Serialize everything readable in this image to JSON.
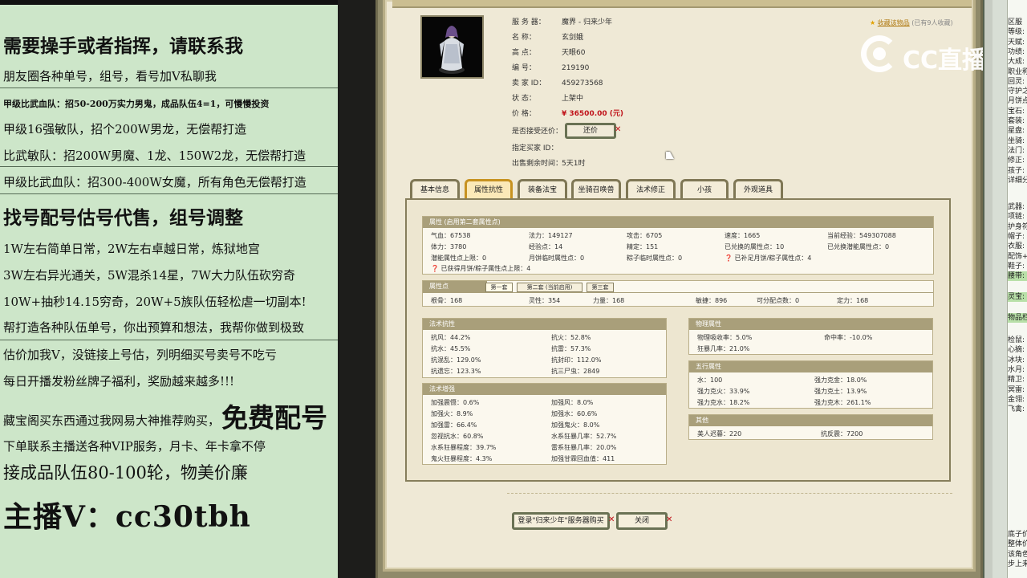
{
  "left_panel": {
    "lines": [
      "需要操手或者指挥，请联系我",
      "朋友圈各种单号，组号，看号加V私聊我",
      "甲级比武血队：招50-200万实力男鬼，成品队伍4=1，可慢慢投资",
      "甲级16强敏队，招个200W男龙，无偿帮打造",
      "比武敏队：招200W男魔、1龙、150W2龙，无偿帮打造",
      "甲级比武血队：招300-400W女魔，所有角色无偿帮打造",
      "找号配号估号代售，组号调整",
      "1W左右简单日常，2W左右卓越日常，炼狱地宫",
      "3W左右异光通关，5W混杀14星，7W大力队伍砍穷奇",
      "10W+抽秒14.15穷奇，20W+5族队伍轻松虐一切副本!",
      "帮打造各种队伍单号，你出预算和想法，我帮你做到极致",
      "估价加我V，没链接上号估，列明细买号卖号不吃亏",
      "每日开播发粉丝牌子福利，奖励越来越多!!!",
      "藏宝阁买东西通过我网易大神推荐购买，",
      "免费配号",
      "下单联系主播送各种VIP服务，月卡、年卡拿不停",
      "接成品队伍80-100轮，物美价廉",
      "主播V：cc30tbh"
    ]
  },
  "game": {
    "info": [
      {
        "label": "服 务 器：",
        "value": "魔界 - 归来少年"
      },
      {
        "label": "名      称：",
        "value": "玄剑娥"
      },
      {
        "label": "高      点：",
        "value": "天眼60"
      },
      {
        "label": "编      号：",
        "value": "219190"
      },
      {
        "label": "卖 家  ID：",
        "value": "459273568"
      },
      {
        "label": "状      态：",
        "value": "上架中"
      },
      {
        "label": "价      格：",
        "value": "¥ 36500.00 (元)"
      },
      {
        "label": "是否接受还价：",
        "value": ""
      },
      {
        "label": "指定买家 ID：",
        "value": ""
      },
      {
        "label": "出售剩余时间：",
        "value": "5天1时"
      }
    ],
    "return_price_button": "还价",
    "favorite": {
      "link": "收藏该物品",
      "count": "(已有9人收藏)"
    },
    "tabs": [
      "基本信息",
      "属性抗性",
      "装备法宝",
      "坐骑召唤兽",
      "法术修正",
      "小孩",
      "外观道具"
    ],
    "active_tab": 1,
    "attributes": {
      "header": "属性 (启用第二套属性点)",
      "rows": [
        [
          "气血：67538",
          "法力：149127",
          "攻击：6705",
          "速度：1665",
          "当前经验：549307088"
        ],
        [
          "体力：3780",
          "经验点：14",
          "精定：151",
          "已兑换的属性点：10",
          "已兑换潜能属性点：0"
        ],
        [
          "潜能属性点上限：0",
          "月饼临时属性点：0",
          "粽子临时属性点：0",
          "已补足月饼/粽子属性点：4",
          ""
        ],
        [
          "已获得月饼/粽子属性点上限：4",
          "",
          "",
          "",
          ""
        ]
      ]
    },
    "points": {
      "header": "属性点",
      "subtabs": [
        "第一套",
        "第二套 (当前启用)",
        "第三套"
      ],
      "row": [
        "根骨：168",
        "灵性：354",
        "力量：168",
        "敏捷：896",
        "可分配点数：0",
        "定力：168"
      ]
    },
    "resist": {
      "header": "法术抗性",
      "rows": [
        [
          "抗风：44.2%",
          "抗火：52.8%"
        ],
        [
          "抗水：45.5%",
          "抗雷：57.3%"
        ],
        [
          "抗混乱：129.0%",
          "抗封印：112.0%"
        ],
        [
          "抗遗忘：123.3%",
          "抗三尸虫：2849"
        ]
      ]
    },
    "enhance": {
      "header": "法术增强",
      "rows": [
        [
          "加强震慑：0.6%",
          "加强风：8.0%"
        ],
        [
          "加强火：8.9%",
          "加强水：60.6%"
        ],
        [
          "加强雷：66.4%",
          "加强鬼火：8.0%"
        ],
        [
          "忽视抗水：60.8%",
          "水系狂暴几率：52.7%"
        ],
        [
          "水系狂暴程度：39.7%",
          "雷系狂暴几率：20.0%"
        ],
        [
          "鬼火狂暴程度：4.3%",
          "加强甘霖回血值：411"
        ]
      ]
    },
    "physical": {
      "header": "物理属性",
      "rows": [
        [
          "物理吸收率：5.0%",
          "命中率：-10.0%"
        ],
        [
          "狂暴几率：21.0%",
          ""
        ]
      ]
    },
    "five": {
      "header": "五行属性",
      "rows": [
        [
          "水：100",
          "强力克金：18.0%"
        ],
        [
          "强力克火：33.9%",
          "强力克土：13.9%"
        ],
        [
          "强力克水：18.2%",
          "强力克木：261.1%"
        ]
      ]
    },
    "other": {
      "header": "其他",
      "rows": [
        [
          "美人迟暮：220",
          "抗反震：7200"
        ]
      ]
    },
    "login_button": "登录\"归来少年\"服务器购买",
    "close_button": "关闭"
  },
  "logo": {
    "text": "CC直播"
  },
  "right_strip": {
    "items": [
      "区服",
      "等级:",
      "天赋:",
      "功绩:",
      "大成:",
      "职业称",
      "回灵:",
      "守护之",
      "月饼点",
      "宝石:",
      "套装:",
      "星盘:",
      "坐骑:",
      "法门:",
      "修正:",
      "孩子:",
      "详细分",
      "武器:",
      "项链:",
      "护身符",
      "帽子:",
      "衣服:",
      "配饰+",
      "鞋子:",
      "腰带:",
      "灵宝:",
      "物品栏",
      "检鼠:",
      "心摘:",
      "冰块:",
      "水月:",
      "精卫:",
      "冥雷:",
      "金翎:",
      "飞禽:",
      "底子价",
      "整体价",
      "该角色",
      "步上来"
    ],
    "highlight_index": [
      24,
      25,
      26
    ]
  }
}
